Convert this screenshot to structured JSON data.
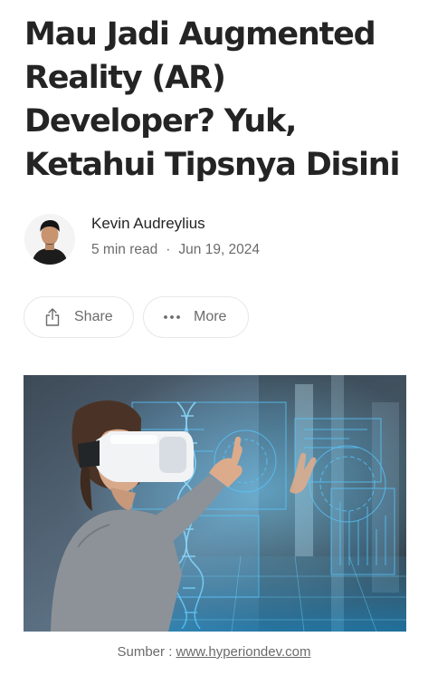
{
  "article": {
    "title": "Mau Jadi Augmented Reality (AR) Developer? Yuk, Ketahui Tipsnya Disini"
  },
  "author": {
    "name": "Kevin Audreylius",
    "read_time": "5 min read",
    "separator": "·",
    "date": "Jun 19, 2024"
  },
  "actions": {
    "share_label": "Share",
    "more_label": "More"
  },
  "hero": {
    "caption_prefix": "Sumber : ",
    "caption_link": "www.hyperiondev.com"
  },
  "colors": {
    "text_primary": "#242424",
    "text_secondary": "#6b6b6b",
    "pill_border": "#e8e8e8",
    "hologram": "#3fb6ff"
  },
  "icons": {
    "share": "share-icon",
    "more": "more-dots-icon"
  }
}
